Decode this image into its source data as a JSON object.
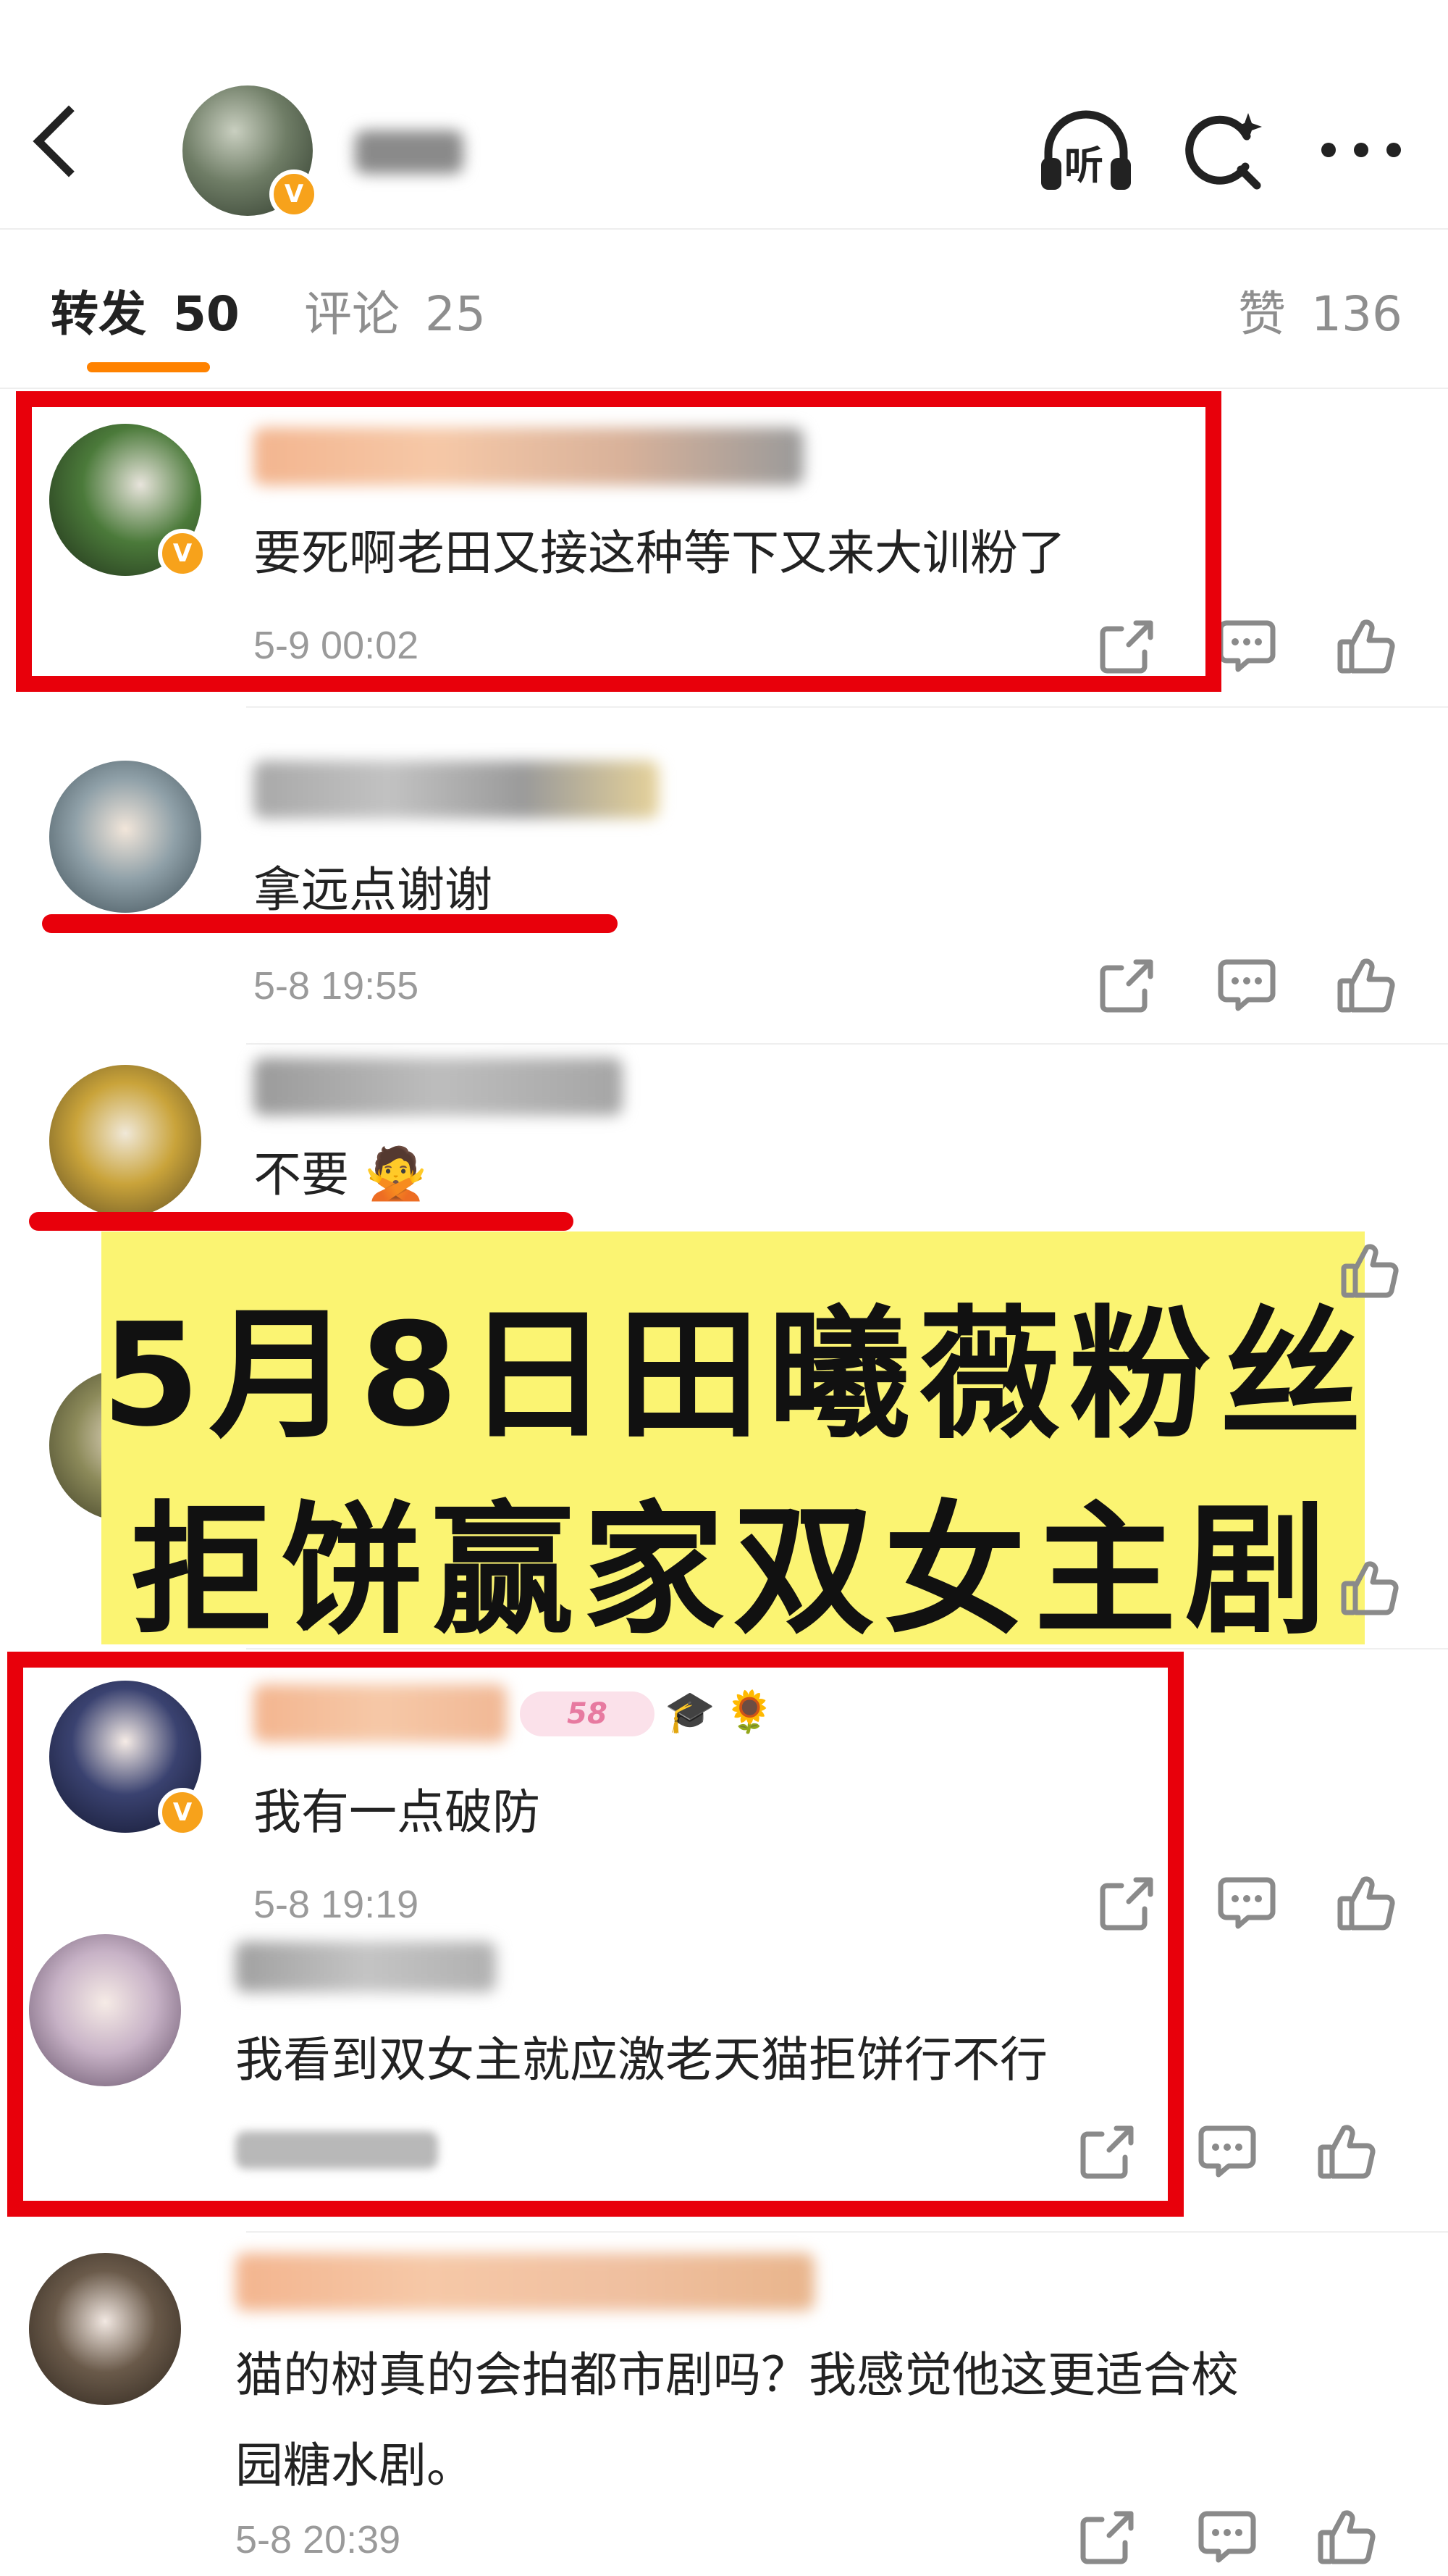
{
  "header": {
    "icons": [
      "back-icon",
      "listen-icon",
      "search-icon",
      "more-icon"
    ],
    "listen_label": "听"
  },
  "tabs": {
    "repost_label": "转发",
    "repost_count": "50",
    "comment_label": "评论",
    "comment_count": "25",
    "like_label": "赞",
    "like_count": "136"
  },
  "comments": [
    {
      "text": "要死啊老田又接这种等下又来大训粉了",
      "time": "5-9 00:02"
    },
    {
      "text": "拿远点谢谢",
      "time": "5-8 19:55"
    },
    {
      "text": "不要",
      "emoji": "🙅"
    },
    {
      "text": "我有一点破防",
      "time": "5-8 19:19",
      "badges": [
        "58",
        "🎓",
        "🌻"
      ]
    },
    {
      "text": "我看到双女主就应激老天猫拒饼行不行"
    },
    {
      "text_line1": "猫的树真的会拍都市剧吗？我感觉他这更适合校",
      "text_line2": "园糖水剧。",
      "time": "5-8 20:39"
    }
  ],
  "banner": {
    "line1": "5月8日田曦薇粉丝",
    "line2": "拒饼赢家双女主剧"
  },
  "colors": {
    "accent": "#ff8200",
    "annotation_red": "#e8000b",
    "banner_yellow": "#fbf472",
    "verified_badge": "#f7a21b"
  }
}
